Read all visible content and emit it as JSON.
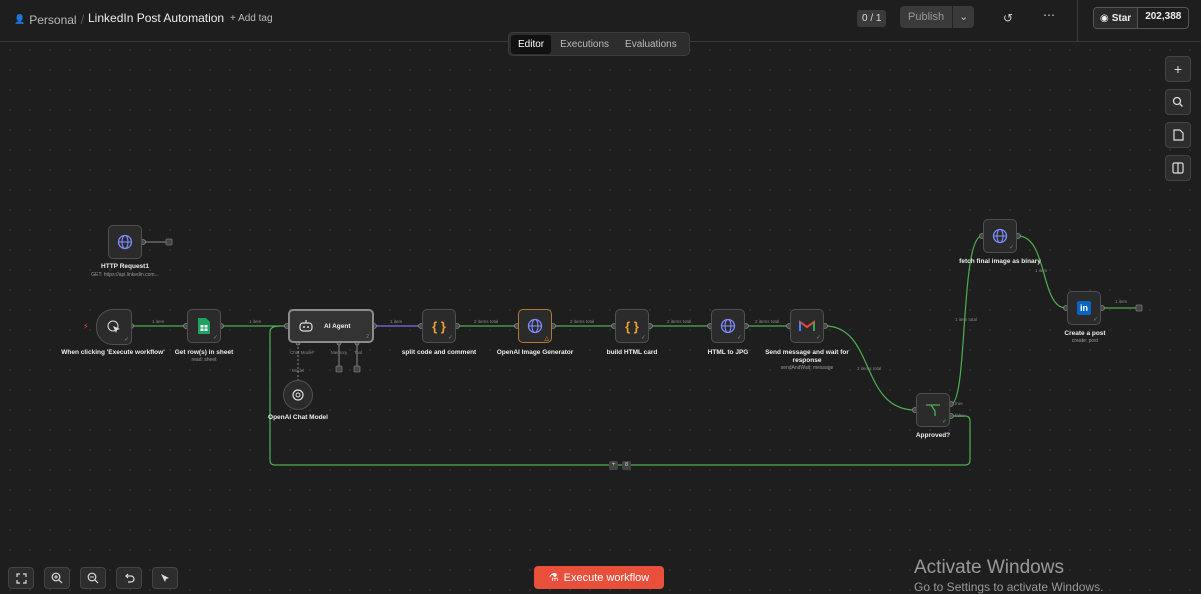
{
  "topbar": {
    "project": "Personal",
    "workflow_name": "LinkedIn Post Automation",
    "add_tag": "+ Add tag",
    "counter": "0 / 1",
    "publish": "Publish",
    "star": "Star",
    "star_count": "202,388"
  },
  "tabs": [
    "Editor",
    "Executions",
    "Evaluations"
  ],
  "execute_button": "Execute workflow",
  "nodes": {
    "http1": {
      "label": "HTTP Request1",
      "sub": "GET: https://api.linkedin.com..."
    },
    "trigger": {
      "label": "When clicking 'Execute workflow'"
    },
    "sheets": {
      "label": "Get row(s) in sheet",
      "sub": "read: sheet"
    },
    "agent": {
      "label": "AI Agent",
      "ports": [
        "Chat Model*",
        "Memory",
        "Tool"
      ]
    },
    "chatmodel": {
      "label": "OpenAI Chat Model",
      "port": "Model"
    },
    "split": {
      "label": "split code and comment"
    },
    "imggen": {
      "label": "OpenAI Image Generator"
    },
    "html": {
      "label": "build HTML card"
    },
    "htmljpg": {
      "label": "HTML to JPG"
    },
    "gmail": {
      "label": "Send message and wait for response",
      "sub": "sendAndWait: message"
    },
    "approved": {
      "label": "Approved?",
      "true_label": "true",
      "false_label": "false"
    },
    "fetch": {
      "label": "fetch final image as binary"
    },
    "linkedin": {
      "label": "Create a post",
      "sub": "create: post"
    }
  },
  "edge_labels": {
    "e1": "1 item",
    "e2": "1 item",
    "e3": "1 item",
    "e4": "2 items total",
    "e5": "2 items total",
    "e6": "2 items total",
    "e7": "2 items total",
    "e8": "2 items total",
    "e9": "1 item total",
    "e10": "1 item",
    "e11": "1 item"
  },
  "counts": {
    "c": "2",
    "loop": "8"
  },
  "watermark": {
    "title": "Activate Windows",
    "sub": "Go to Settings to activate Windows."
  }
}
